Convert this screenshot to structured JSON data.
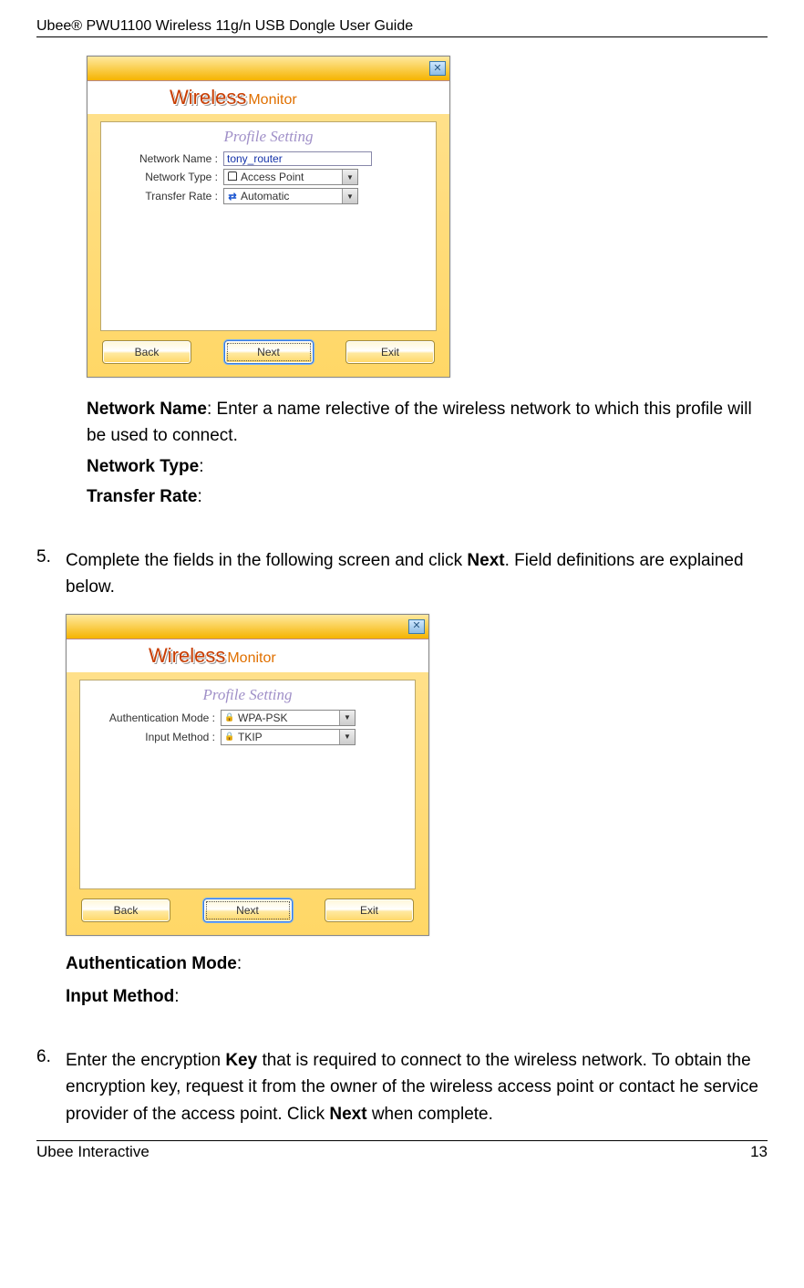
{
  "header": "Ubee® PWU1100 Wireless 11g/n USB Dongle User Guide",
  "footer_left": "Ubee Interactive",
  "footer_right": "13",
  "dialog_app_name_big": "Wireless",
  "dialog_app_name_small": "Monitor",
  "dialog1": {
    "panel_title": "Profile Setting",
    "rows": [
      {
        "label": "Network Name :",
        "type": "text",
        "value": "tony_router"
      },
      {
        "label": "Network Type :",
        "type": "dropdown",
        "value": "Access Point",
        "icon": "ap"
      },
      {
        "label": "Transfer Rate :",
        "type": "dropdown",
        "value": "Automatic",
        "icon": "rate"
      }
    ],
    "buttons": [
      "Back",
      "Next",
      "Exit"
    ]
  },
  "defs1": {
    "network_name_label": "Network Name",
    "network_name_text": ": Enter a name relective of the wireless network to which this profile will be used to connect.",
    "network_type_label": "Network Type",
    "transfer_rate_label": "Transfer Rate"
  },
  "step5": {
    "num": "5.",
    "text_a": "Complete the fields in the following screen and click ",
    "text_bold": "Next",
    "text_b": ". Field definitions are explained below."
  },
  "dialog2": {
    "panel_title": "Profile Setting",
    "rows": [
      {
        "label": "Authentication Mode :",
        "type": "dropdown",
        "value": "WPA-PSK",
        "icon": "lock"
      },
      {
        "label": "Input Method :",
        "type": "dropdown",
        "value": "TKIP",
        "icon": "lock"
      }
    ],
    "buttons": [
      "Back",
      "Next",
      "Exit"
    ]
  },
  "defs2": {
    "auth_mode_label": "Authentication Mode",
    "input_method_label": "Input Method"
  },
  "step6": {
    "num": "6.",
    "text_a": "Enter the encryption ",
    "text_key": "Key",
    "text_b": " that is required to connect to the wireless network. To obtain the encryption key, request it from the owner of the wireless access point or contact he service provider of the access point. Click ",
    "text_next": "Next",
    "text_c": " when complete."
  }
}
